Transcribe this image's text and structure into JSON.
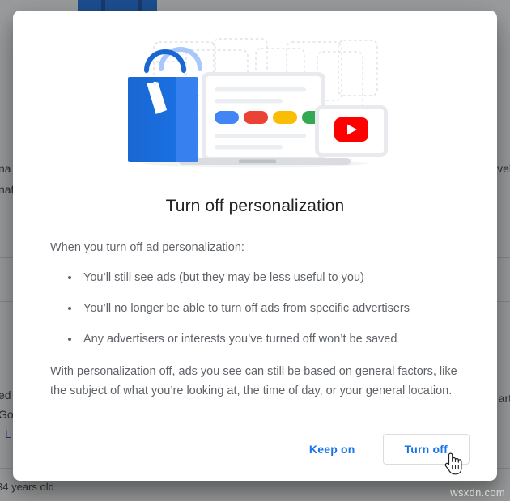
{
  "dialog": {
    "title": "Turn off personalization",
    "intro": "When you turn off ad personalization:",
    "bullets": [
      "You’ll still see ads (but they may be less useful to you)",
      "You’ll no longer be able to turn off ads from specific advertisers",
      "Any advertisers or interests you’ve turned off won’t be saved"
    ],
    "closing": "With personalization off, ads you see can still be based on general factors, like the subject of what you’re looking at, the time of day, or your general location.",
    "buttons": {
      "keep_on": "Keep on",
      "turn_off": "Turn off"
    },
    "illustration": {
      "name": "ads-personalization-illustration",
      "elements": [
        "shopping-bag-icon",
        "laptop-browser-icon",
        "youtube-play-icon",
        "dotted-grid-pattern"
      ],
      "chip_colors": [
        "#4285f4",
        "#ea4335",
        "#fbbc04",
        "#34a853"
      ],
      "bag_color": "#1a73e8",
      "youtube_color": "#ff0000"
    }
  },
  "background": {
    "fragment_left_1": "na",
    "fragment_left_2": "nat",
    "fragment_right_1": "vel",
    "fragment_left_3": "ed",
    "fragment_left_4": "Go",
    "fragment_left_link": "L",
    "fragment_right_2": "art",
    "fragment_bottom": "34 years old"
  },
  "watermark": "wsxdn.com",
  "colors": {
    "accent": "#1a73e8",
    "text_primary": "#202124",
    "text_secondary": "#5f6368",
    "border": "#dadce0",
    "scrim": "#202124"
  }
}
